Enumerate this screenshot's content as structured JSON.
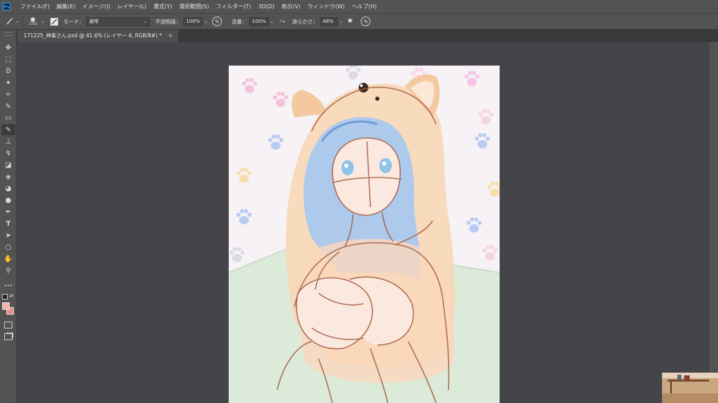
{
  "menubar": {
    "app_icon": "Ps",
    "items": [
      "ファイル(F)",
      "編集(E)",
      "イメージ(I)",
      "レイヤー(L)",
      "書式(Y)",
      "選択範囲(S)",
      "フィルター(T)",
      "3D(D)",
      "表示(V)",
      "ウィンドウ(W)",
      "ヘルプ(H)"
    ]
  },
  "options": {
    "brush_size": "1102",
    "mode_label": "モード：",
    "mode_value": "通常",
    "opacity_label": "不透明度：",
    "opacity_value": "100%",
    "flow_label": "流量：",
    "flow_value": "100%",
    "smoothing_label": "滑らかさ：",
    "smoothing_value": "48%"
  },
  "document": {
    "tab_title": "171225_神楽さん.psd @ 41.6% (レイヤー 4, RGB/8#) *",
    "close_glyph": "×"
  },
  "tools": [
    {
      "name": "move-tool",
      "glyph": "✥"
    },
    {
      "name": "marquee-tool",
      "glyph": "⬚"
    },
    {
      "name": "lasso-tool",
      "glyph": "ᘐ"
    },
    {
      "name": "magic-wand-tool",
      "glyph": "✦"
    },
    {
      "name": "crop-tool",
      "glyph": "⌗"
    },
    {
      "name": "eyedropper-tool",
      "glyph": "✎"
    },
    {
      "name": "healing-brush-tool",
      "glyph": "▭"
    },
    {
      "name": "brush-tool",
      "glyph": "✎"
    },
    {
      "name": "clone-stamp-tool",
      "glyph": "⊥"
    },
    {
      "name": "history-brush-tool",
      "glyph": "↯"
    },
    {
      "name": "eraser-tool",
      "glyph": "◪"
    },
    {
      "name": "paint-bucket-tool",
      "glyph": "◈"
    },
    {
      "name": "blur-tool",
      "glyph": "◕"
    },
    {
      "name": "dodge-tool",
      "glyph": "●"
    },
    {
      "name": "pen-tool",
      "glyph": "✒"
    },
    {
      "name": "type-tool",
      "glyph": "T"
    },
    {
      "name": "path-selection-tool",
      "glyph": "➤"
    },
    {
      "name": "ellipse-tool",
      "glyph": "○"
    },
    {
      "name": "hand-tool",
      "glyph": "✋"
    },
    {
      "name": "zoom-tool",
      "glyph": "⚲"
    },
    {
      "name": "more-tools",
      "glyph": "•••"
    }
  ],
  "colors": {
    "foreground": "#f3b6ae",
    "background": "#ec8f86",
    "workspace": "#454549",
    "panel": "#535353"
  }
}
